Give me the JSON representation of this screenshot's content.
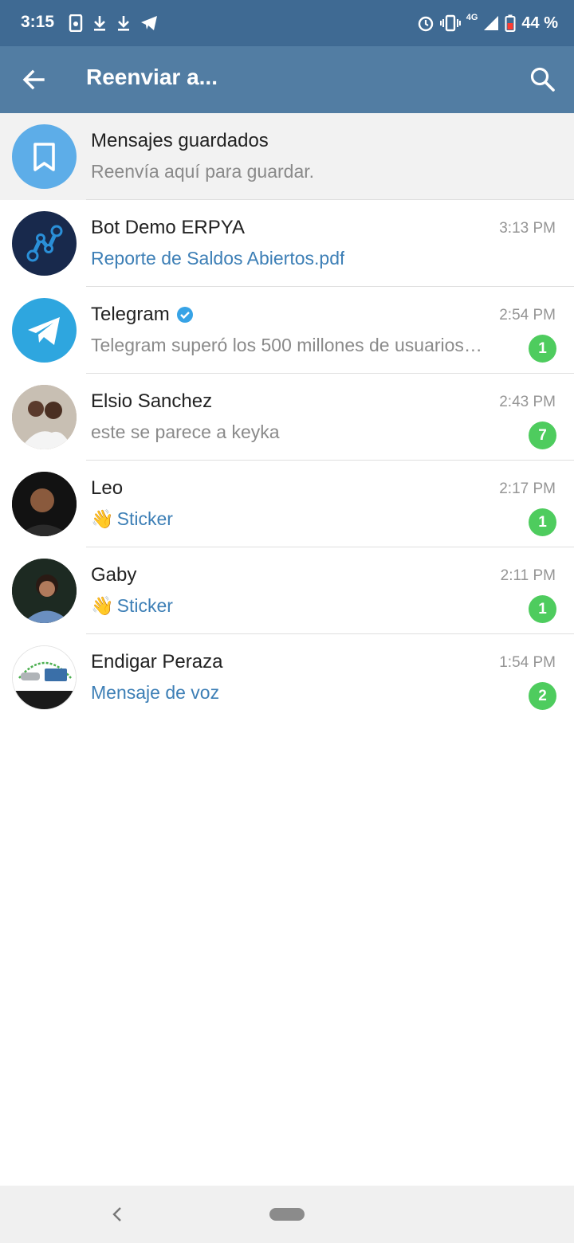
{
  "status_bar": {
    "time": "3:15",
    "network": "4G",
    "battery": "44 %",
    "left_icons": [
      "sim-icon",
      "download-icon",
      "download-icon",
      "telegram-icon"
    ],
    "right_icons": [
      "alarm-icon",
      "vibrate-icon",
      "signal-icon",
      "battery-icon"
    ]
  },
  "toolbar": {
    "title": "Reenviar a...",
    "back_icon": "arrow-left-icon",
    "search_icon": "search-icon",
    "color": "#527da3"
  },
  "chats": [
    {
      "name": "Mensajes guardados",
      "preview": "Reenvía aquí para guardar.",
      "preview_style": "gray",
      "time": "",
      "unread": "",
      "avatar": "bookmark-avatar",
      "highlighted": true
    },
    {
      "name": "Bot Demo ERPYA",
      "preview": "Reporte de Saldos Abiertos.pdf",
      "preview_style": "blue",
      "time": "3:13 PM",
      "unread": "",
      "avatar": "bot-avatar"
    },
    {
      "name": "Telegram",
      "verified": true,
      "preview": "Telegram superó los 500 millones de usuarios…",
      "preview_style": "gray",
      "time": "2:54 PM",
      "unread": "1",
      "avatar": "telegram-avatar"
    },
    {
      "name": "Elsio Sanchez",
      "preview": "este se parece a keyka",
      "preview_style": "gray",
      "time": "2:43 PM",
      "unread": "7",
      "avatar": "photo-avatar"
    },
    {
      "name": "Leo",
      "preview_emoji": "👋",
      "preview": "Sticker",
      "preview_style": "blue",
      "time": "2:17 PM",
      "unread": "1",
      "avatar": "photo-avatar"
    },
    {
      "name": "Gaby",
      "preview_emoji": "👋",
      "preview": "Sticker",
      "preview_style": "blue",
      "time": "2:11 PM",
      "unread": "1",
      "avatar": "photo-avatar"
    },
    {
      "name": "Endigar Peraza",
      "preview": "Mensaje de voz",
      "preview_style": "blue",
      "time": "1:54 PM",
      "unread": "2",
      "avatar": "logo-avatar"
    }
  ],
  "colors": {
    "badge": "#4ecc5e",
    "link_preview": "#3d7fb6",
    "status_bar": "#3f6a93"
  }
}
